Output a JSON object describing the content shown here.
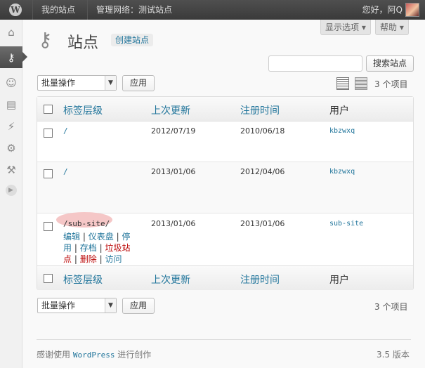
{
  "adminbar": {
    "my_sites": "我的站点",
    "network_admin": "管理网络：测试站点",
    "greeting": "您好，阿Q"
  },
  "screen_meta": {
    "screen_options": "显示选项",
    "help": "帮助"
  },
  "page": {
    "title": "站点",
    "add_new": "创建站点"
  },
  "search": {
    "value": "",
    "button": "搜索站点"
  },
  "bulk": {
    "selected": "批量操作",
    "apply": "应用"
  },
  "items_count": "3 个项目",
  "columns": {
    "path": "标签层级",
    "lastupdated": "上次更新",
    "registered": "注册时间",
    "users": "用户"
  },
  "rows": [
    {
      "path": "/",
      "lastupdated": "2012/07/19",
      "registered": "2010/06/18",
      "user": "kbzwxq"
    },
    {
      "path": "/",
      "lastupdated": "2013/01/06",
      "registered": "2012/04/06",
      "user": "kbzwxq"
    },
    {
      "path": "/sub-site/",
      "lastupdated": "2013/01/06",
      "registered": "2013/01/06",
      "user": "sub-site",
      "actions": {
        "edit": "编辑",
        "dashboard": "仪表盘",
        "deactivate_1": "停",
        "deactivate_2": "用",
        "archive": "存档",
        "spam_1": "垃圾站",
        "spam_2": "点",
        "delete": "删除",
        "visit": "访问",
        "sep": "|"
      }
    }
  ],
  "footer": {
    "thanks_prefix": "感谢使用",
    "thanks_brand": "WordPress",
    "thanks_suffix": "进行创作",
    "version": "3.5 版本"
  },
  "icons": [
    "wordpress-logo-icon",
    "dashboard-icon",
    "sites-icon",
    "users-icon",
    "themes-icon",
    "plugins-icon",
    "settings-icon",
    "tools-icon",
    "collapse-icon",
    "list-view-icon",
    "excerpt-view-icon"
  ]
}
